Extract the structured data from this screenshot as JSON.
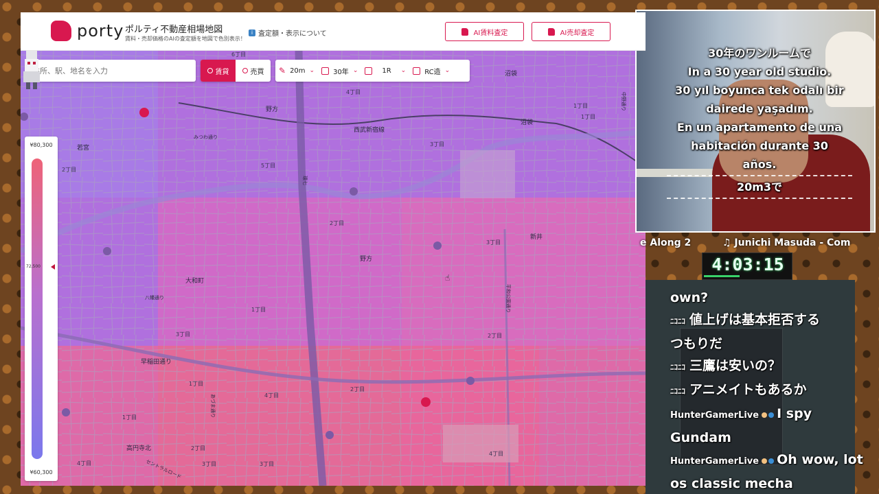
{
  "app": {
    "logo_text": "porty",
    "title": "ポルティ不動産相場地図",
    "subtitle": "賃料・売却価格のAIの査定額を地図で色別表示！",
    "info_link": "査定額・表示について",
    "ai_rent_button": "AI賃料査定",
    "ai_sale_button": "AI売却査定"
  },
  "search": {
    "placeholder": "住所、駅、地名を入力"
  },
  "mode_toggle": {
    "rent": "賃貸",
    "sale": "売買",
    "selected": "rent"
  },
  "filters": {
    "area": "20m",
    "age": "30年",
    "layout": "1R",
    "structure": "RC造"
  },
  "legend": {
    "max": "¥80,300",
    "current": "72,500",
    "min": "¥60,300",
    "current_fraction_from_top": 0.36
  },
  "map_labels": {
    "chome": [
      "6丁目",
      "4丁目",
      "3丁目",
      "5丁目",
      "2丁目",
      "1丁目",
      "3丁目",
      "1丁目",
      "2丁目",
      "3丁目",
      "1丁目",
      "2丁目",
      "4丁目",
      "3丁目",
      "3丁目",
      "2丁目",
      "1丁目",
      "4丁目",
      "4丁目",
      "1丁目",
      "2丁目"
    ],
    "places": [
      "沼袋",
      "若宮",
      "大和町",
      "野方",
      "野方",
      "新井",
      "高円寺北",
      "早稲田通り",
      "西武新宿線",
      "沼袋",
      "平和公園通り",
      "環七",
      "中野通り",
      "八幡通り",
      "セントラルロード",
      "みつわ通り",
      "あづま通り"
    ]
  },
  "stream": {
    "captions": {
      "lines": [
        "30年のワンルームで",
        "In a 30 year old studio.",
        "30 yıl boyunca tek odalı bir",
        "dairede yaşadım.",
        "En un apartamento de una",
        "habitación durante 30",
        "años."
      ],
      "secondary": "20m3で"
    },
    "ticker_left": "e Along 2",
    "ticker_right": "♫ Junichi Masuda - Com",
    "timer": "4:03:15",
    "chat": [
      {
        "source": "",
        "user": "",
        "text": "own?"
      },
      {
        "source": "ﾆｺﾆｺ",
        "user": "",
        "text": "値上げは基本拒否する"
      },
      {
        "source": "",
        "user": "",
        "text": "つもりだ"
      },
      {
        "source": "ﾆｺﾆｺ",
        "user": "",
        "text": "三鷹は安いの？"
      },
      {
        "source": "ﾆｺﾆｺ",
        "user": "",
        "text": "アニメイトもあるか"
      },
      {
        "source": "",
        "user": "HunterGamerLive",
        "text": "I spy"
      },
      {
        "source": "",
        "user": "",
        "text": "Gundam"
      },
      {
        "source": "",
        "user": "HunterGamerLive",
        "text": "Oh wow, lot"
      },
      {
        "source": "",
        "user": "",
        "text": "os classic mecha"
      }
    ]
  },
  "colors": {
    "brand": "#d8184f",
    "legend_top": "#ee6378",
    "legend_bottom": "#7b78ec",
    "timer_accent": "#39d36a"
  }
}
